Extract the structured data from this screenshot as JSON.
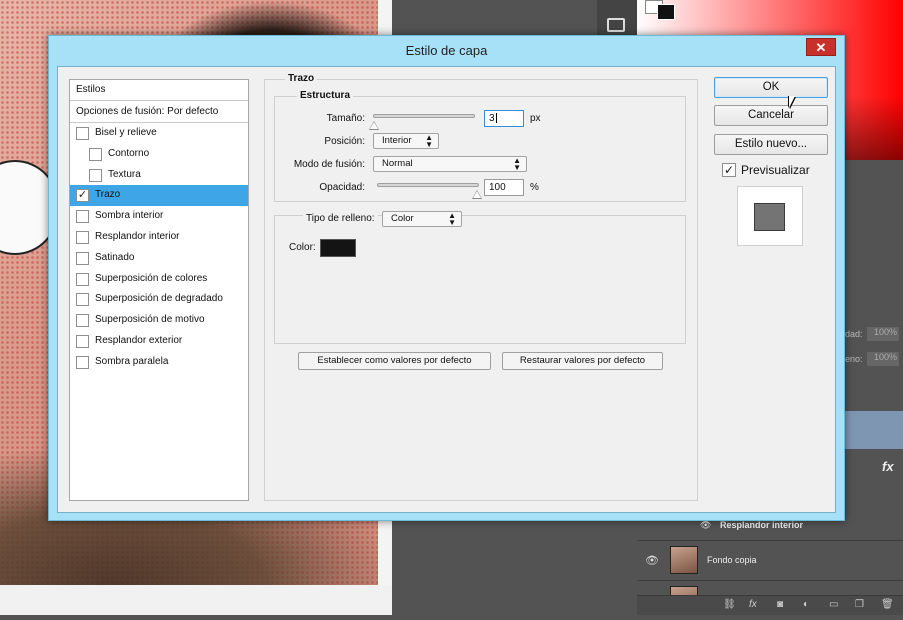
{
  "dialog": {
    "title": "Estilo de capa",
    "close_label": "✕"
  },
  "styles_panel": {
    "header": "Estilos",
    "blend_options": "Opciones de fusión: Por defecto",
    "items": [
      {
        "label": "Bisel y relieve",
        "checked": false,
        "indent": false
      },
      {
        "label": "Contorno",
        "checked": false,
        "indent": true
      },
      {
        "label": "Textura",
        "checked": false,
        "indent": true
      },
      {
        "label": "Trazo",
        "checked": true,
        "indent": false,
        "selected": true
      },
      {
        "label": "Sombra interior",
        "checked": false,
        "indent": false
      },
      {
        "label": "Resplandor interior",
        "checked": false,
        "indent": false
      },
      {
        "label": "Satinado",
        "checked": false,
        "indent": false
      },
      {
        "label": "Superposición de colores",
        "checked": false,
        "indent": false
      },
      {
        "label": "Superposición de degradado",
        "checked": false,
        "indent": false
      },
      {
        "label": "Superposición de motivo",
        "checked": false,
        "indent": false
      },
      {
        "label": "Resplandor exterior",
        "checked": false,
        "indent": false
      },
      {
        "label": "Sombra paralela",
        "checked": false,
        "indent": false
      }
    ]
  },
  "stroke": {
    "section_title": "Trazo",
    "structure_title": "Estructura",
    "size_label": "Tamaño:",
    "size_value": "3",
    "size_unit": "px",
    "size_fraction": 0.01,
    "position_label": "Posición:",
    "position_value": "Interior",
    "blend_mode_label": "Modo de fusión:",
    "blend_mode_value": "Normal",
    "opacity_label": "Opacidad:",
    "opacity_value": "100",
    "opacity_unit": "%",
    "opacity_fraction": 1.0,
    "fill_type_label": "Tipo de relleno:",
    "fill_type_value": "Color",
    "color_label": "Color:",
    "stroke_color": "#141414",
    "set_default_label": "Establecer como valores por defecto",
    "reset_default_label": "Restaurar valores por defecto"
  },
  "actions": {
    "ok_label": "OK",
    "cancel_label": "Cancelar",
    "new_style_label": "Estilo nuevo...",
    "preview_label": "Previsualizar",
    "preview_checked": true,
    "preview_color": "#747474"
  },
  "background_app": {
    "layers": {
      "opacity_label_partial": "dad:",
      "opacity_value": "100%",
      "fill_label_partial": "eno:",
      "fill_value": "100%",
      "effect_name": "Resplandor interior",
      "layer_name": "Fondo copia",
      "fx_label": "fx"
    }
  }
}
